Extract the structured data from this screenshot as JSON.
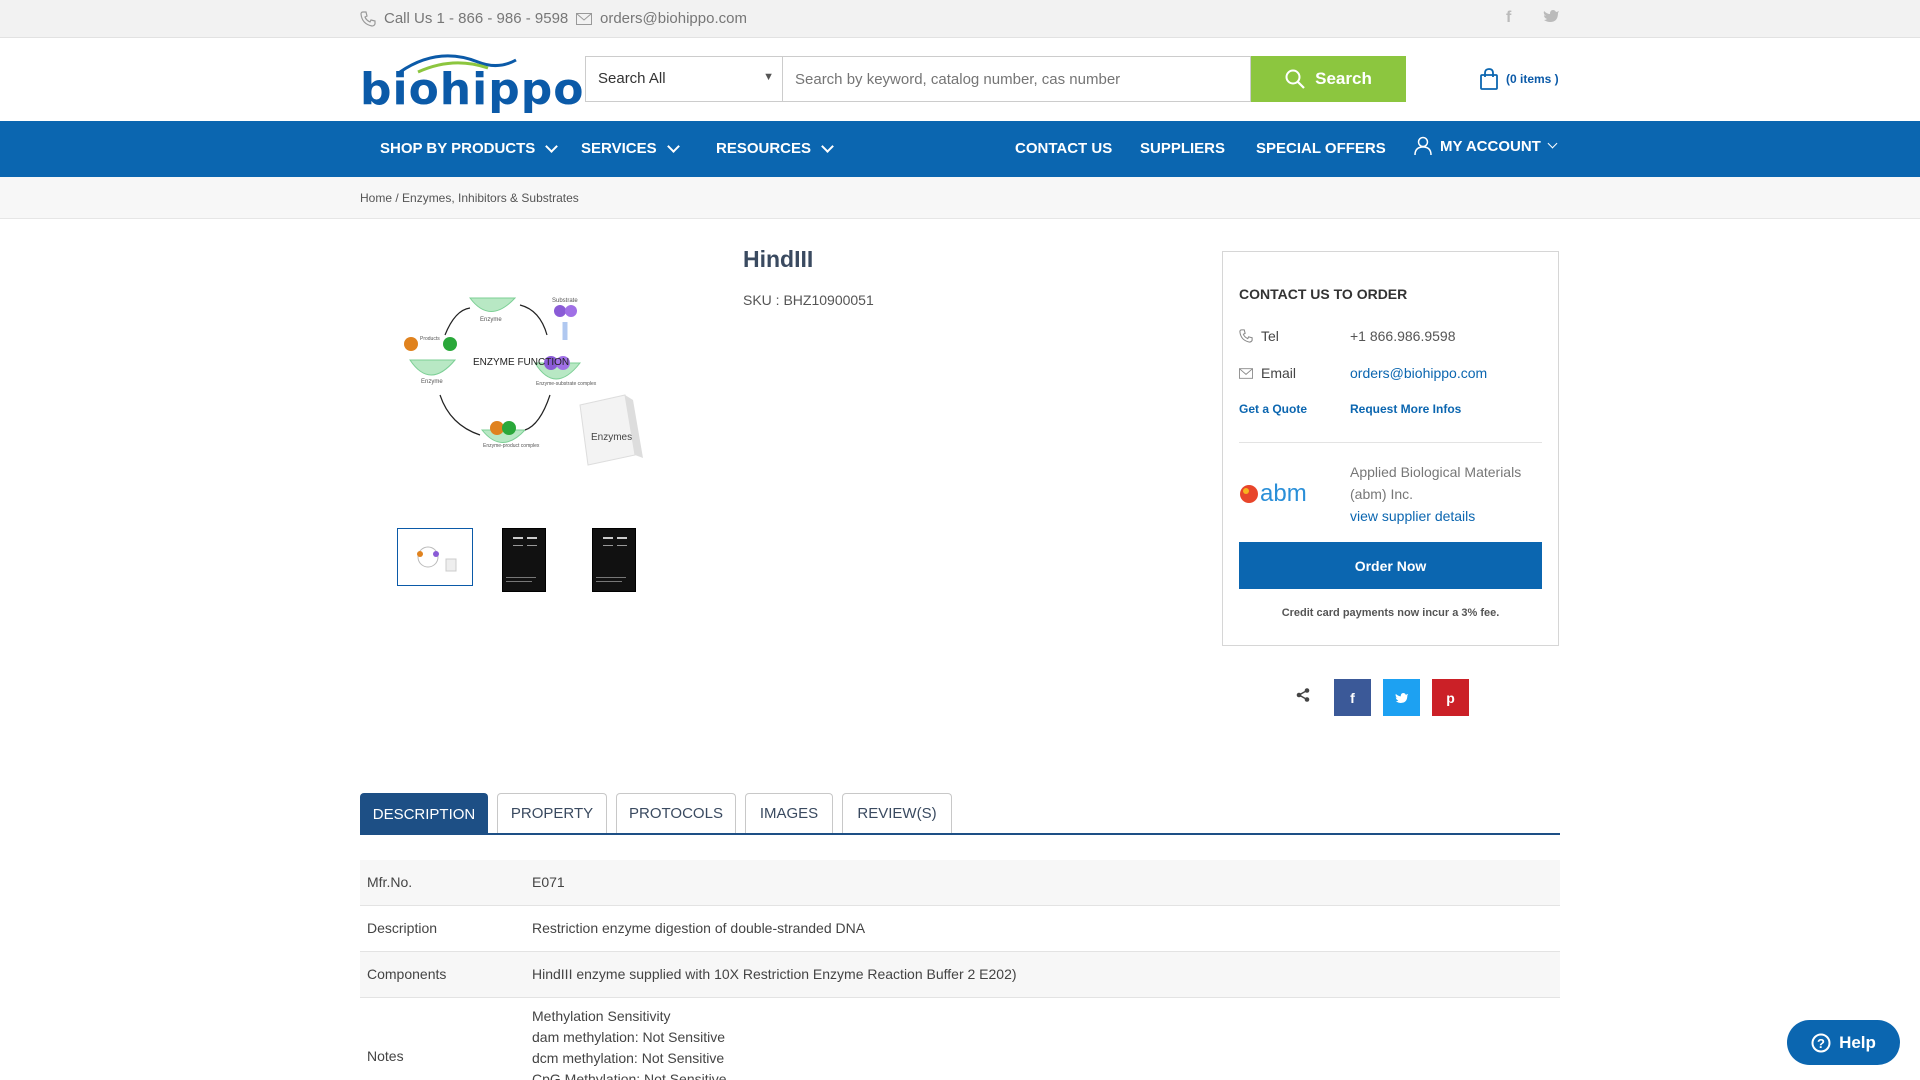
{
  "topbar": {
    "phone": "Call Us 1 - 866 - 986 - 9598",
    "email": "orders@biohippo.com",
    "social": [
      "f",
      "t"
    ]
  },
  "header": {
    "logo_text": "biohippo",
    "search_category": "Search All",
    "search_placeholder": "Search by keyword, catalog number, cas number",
    "search_button": "Search",
    "cart": "(0 items )"
  },
  "nav": {
    "left": [
      "SHOP BY PRODUCTS",
      "SERVICES",
      "RESOURCES"
    ],
    "right": [
      "CONTACT US",
      "SUPPLIERS",
      "SPECIAL OFFERS",
      "MY ACCOUNT"
    ]
  },
  "breadcrumb": "Home / Enzymes, Inhibitors & Substrates",
  "product": {
    "title": "HindIII",
    "sku": "SKU : BHZ10900051",
    "image_labels": {
      "enzyme": "Enzyme",
      "substrate": "Substrate",
      "products": "Products",
      "center": "ENZYME FUNCTION",
      "complex1": "Enzyme-substrate complex",
      "complex2": "Enzyme-product complex",
      "box": "Enzymes"
    }
  },
  "order": {
    "heading": "CONTACT US TO ORDER",
    "tel_label": "Tel",
    "tel_value": "+1 866.986.9598",
    "email_label": "Email",
    "email_value": "orders@biohippo.com",
    "quote": "Get a Quote",
    "info": "Request More Infos",
    "supplier_name": "Applied Biological Materials (abm) Inc.",
    "supplier_link": "view supplier details",
    "supplier_logo": "abm",
    "order_button": "Order Now",
    "note": "Credit card payments now incur a 3% fee."
  },
  "share": {
    "facebook": "f",
    "twitter": "t",
    "pinterest": "p"
  },
  "tabs": [
    "DESCRIPTION",
    "PROPERTY",
    "PROTOCOLS",
    "IMAGES",
    "REVIEW(S)"
  ],
  "details": [
    {
      "key": "Mfr.No.",
      "value": [
        "E071"
      ]
    },
    {
      "key": "Description",
      "value": [
        "Restriction enzyme digestion of double-stranded DNA"
      ]
    },
    {
      "key": "Components",
      "value": [
        "HindIII enzyme supplied with 10X Restriction Enzyme Reaction Buffer 2 E202)"
      ]
    },
    {
      "key": "Notes",
      "value": [
        "Methylation Sensitivity",
        "dam methylation: Not Sensitive",
        "dcm methylation: Not Sensitive",
        "CpG Methylation: Not Sensitive"
      ]
    }
  ],
  "help": "Help",
  "colors": {
    "brand_blue": "#0b66b0",
    "search_green": "#8cc63f",
    "tab_navy": "#1d4f85"
  }
}
